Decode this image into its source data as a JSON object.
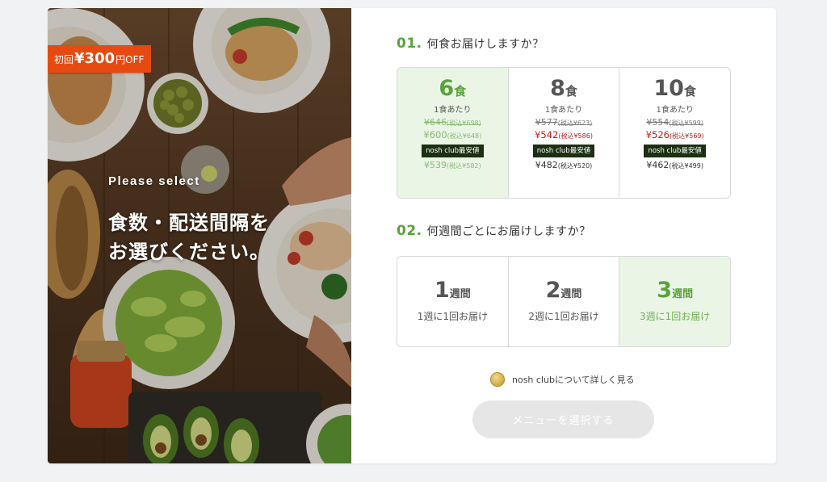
{
  "hero": {
    "badge": {
      "prefix": "初回",
      "amount": "¥300",
      "suffix": "円OFF"
    },
    "eyebrow": "Please select",
    "headline_line1": "食数・配送間隔を",
    "headline_line2": "お選びください。"
  },
  "meal_question": {
    "number": "01.",
    "text": "何食お届けしますか？",
    "selected_index": 0,
    "options": [
      {
        "count": "6",
        "unit": "食",
        "per": "1食あたり",
        "old_price": "¥646",
        "old_price_tax": "(税込¥698)",
        "new_price": "¥600",
        "new_price_tax": "(税込¥648)",
        "club_tag": "nosh club最安値",
        "club_price": "¥539",
        "club_price_tax": "(税込¥582)"
      },
      {
        "count": "8",
        "unit": "食",
        "per": "1食あたり",
        "old_price": "¥577",
        "old_price_tax": "(税込¥623)",
        "new_price": "¥542",
        "new_price_tax": "(税込¥586)",
        "club_tag": "nosh club最安値",
        "club_price": "¥482",
        "club_price_tax": "(税込¥520)"
      },
      {
        "count": "10",
        "unit": "食",
        "per": "1食あたり",
        "old_price": "¥554",
        "old_price_tax": "(税込¥599)",
        "new_price": "¥526",
        "new_price_tax": "(税込¥569)",
        "club_tag": "nosh club最安値",
        "club_price": "¥462",
        "club_price_tax": "(税込¥499)"
      }
    ]
  },
  "week_question": {
    "number": "02.",
    "text": "何週間ごとにお届けしますか？",
    "selected_index": 2,
    "options": [
      {
        "count": "1",
        "unit": "週間",
        "sub": "1週に1回お届け"
      },
      {
        "count": "2",
        "unit": "週間",
        "sub": "2週に1回お届け"
      },
      {
        "count": "3",
        "unit": "週間",
        "sub": "3週に1回お届け"
      }
    ]
  },
  "club_link": {
    "icon": "coin-icon",
    "text": "nosh clubについて詳しく見る"
  },
  "cta": {
    "label": "メニューを選択する",
    "enabled": false
  },
  "colors": {
    "accent": "#5aa23c",
    "badge": "#e74a10",
    "price_red": "#b81c1c",
    "selected_bg": "#eaf5e6"
  }
}
